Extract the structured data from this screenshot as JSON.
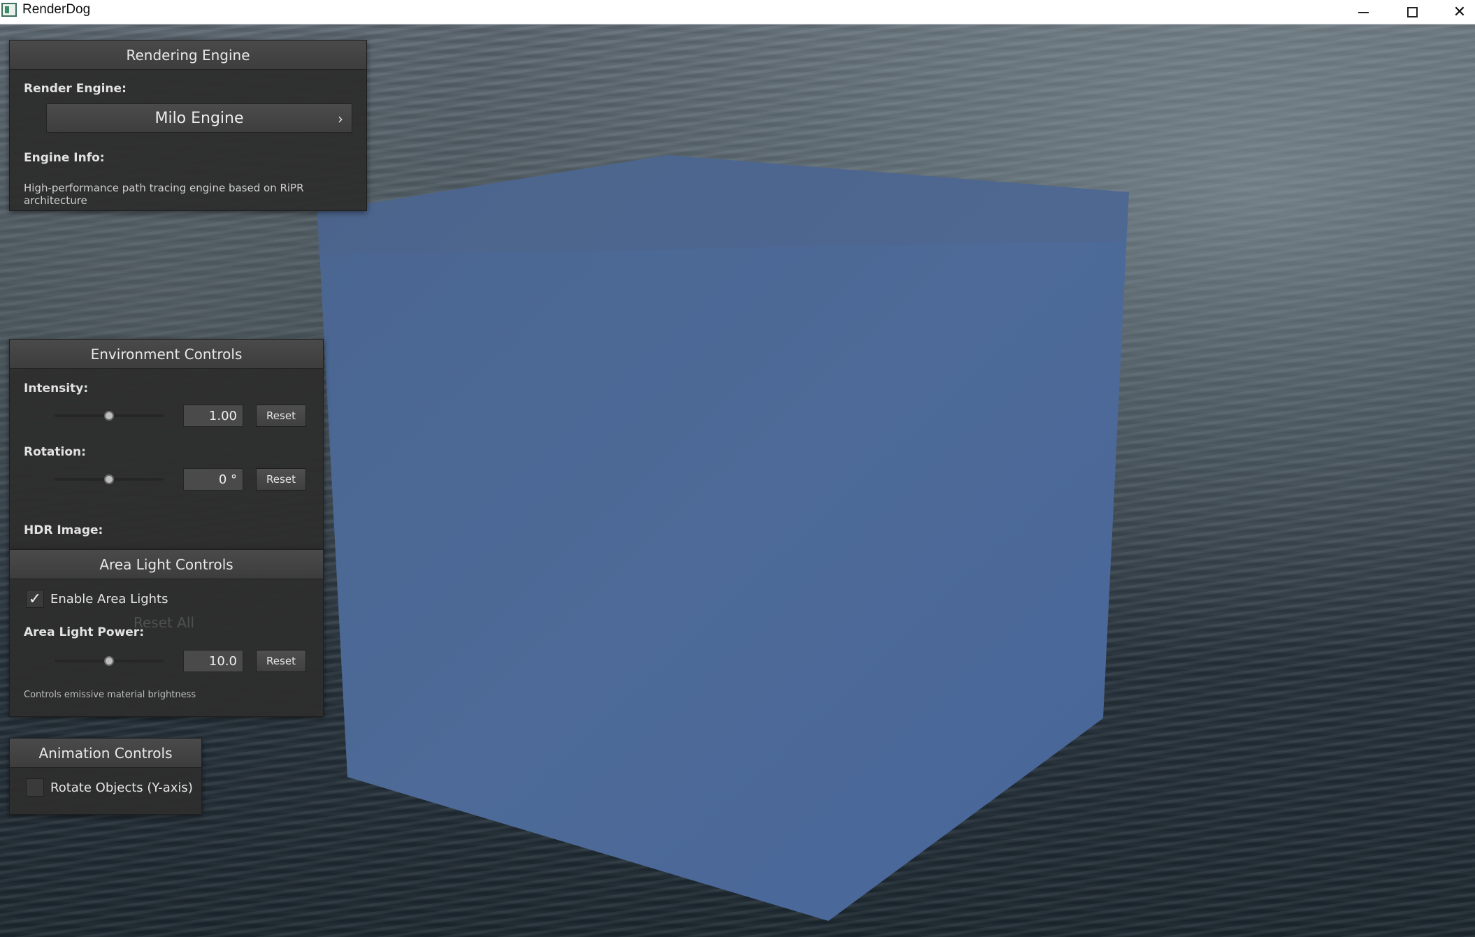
{
  "window": {
    "title": "RenderDog"
  },
  "rendering_engine": {
    "header": "Rendering Engine",
    "render_engine_label": "Render Engine:",
    "selected_engine": "Milo Engine",
    "engine_info_label": "Engine Info:",
    "engine_info_text": "High-performance path tracing engine based on RiPR architecture"
  },
  "environment": {
    "header": "Environment Controls",
    "intensity_label": "Intensity:",
    "intensity_value": "1.00",
    "intensity_fraction": 0.5,
    "rotation_label": "Rotation:",
    "rotation_value": "0 °",
    "rotation_fraction": 0.5,
    "reset_label": "Reset",
    "hdr_label": "HDR Image:",
    "reset_all_label": "Reset All"
  },
  "area_light": {
    "header": "Area Light Controls",
    "enable_label": "Enable Area Lights",
    "enabled": true,
    "power_label": "Area Light Power:",
    "power_value": "10.0",
    "power_fraction": 0.5,
    "reset_label": "Reset",
    "hint": "Controls emissive material brightness"
  },
  "animation": {
    "header": "Animation Controls",
    "rotate_label": "Rotate Objects (Y-axis)",
    "rotate_enabled": false
  },
  "colors": {
    "cube": "#4a6795",
    "panel": "#2e2e2e"
  }
}
